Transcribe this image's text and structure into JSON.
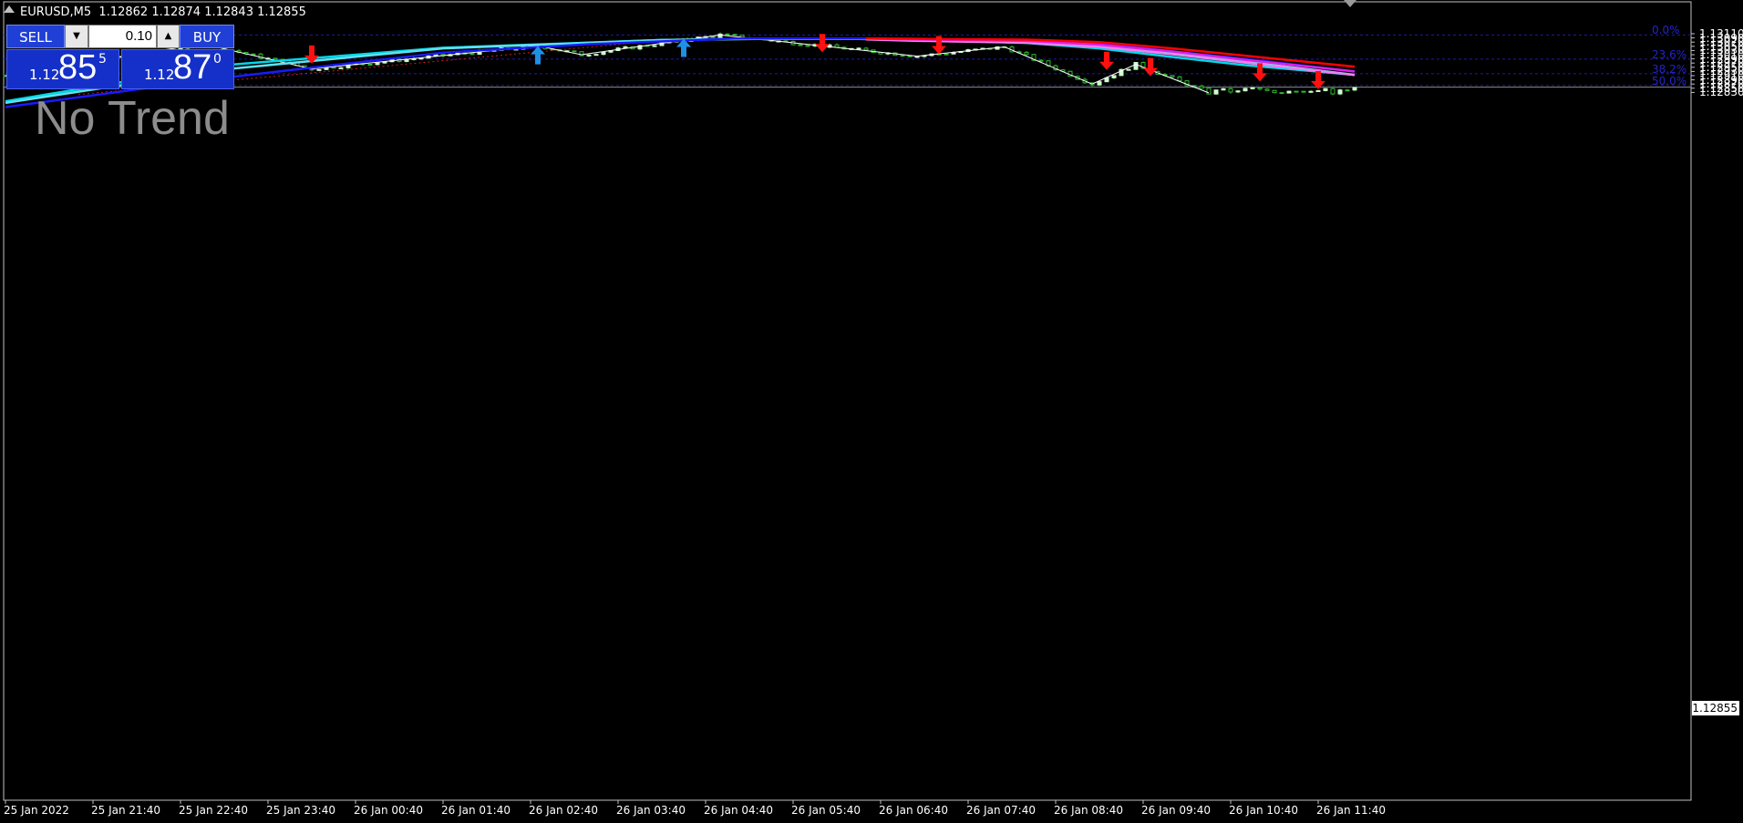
{
  "header": {
    "title": "EURUSD,M5  1.12862 1.12874 1.12843 1.12855"
  },
  "trade_panel": {
    "sell_label": "SELL",
    "buy_label": "BUY",
    "lot": "0.10",
    "sell_small": "1.12",
    "sell_big": "85",
    "sell_sup": "5",
    "buy_small": "1.12",
    "buy_big": "87",
    "buy_sup": "0"
  },
  "trend_label": "No Trend",
  "price_axis": [
    "1.13110",
    "1.13090",
    "1.13070",
    "1.13050",
    "1.13030",
    "1.13010",
    "1.12990",
    "1.12970",
    "1.12950",
    "1.12930",
    "1.12910",
    "1.12890",
    "1.12870",
    "1.12850",
    "1.12830"
  ],
  "current_price": "1.12855",
  "fib_levels": [
    {
      "label": "0.0%",
      "price": 1.13104
    },
    {
      "label": "23.6%",
      "price": 1.12989
    },
    {
      "label": "38.2%",
      "price": 1.12919
    },
    {
      "label": "50.0%",
      "price": 1.12863
    }
  ],
  "time_axis": [
    "25 Jan 2022",
    "25 Jan 21:40",
    "25 Jan 22:40",
    "25 Jan 23:40",
    "26 Jan 00:40",
    "26 Jan 01:40",
    "26 Jan 02:40",
    "26 Jan 03:40",
    "26 Jan 04:40",
    "26 Jan 05:40",
    "26 Jan 06:40",
    "26 Jan 07:40",
    "26 Jan 08:40",
    "26 Jan 09:40",
    "26 Jan 10:40",
    "26 Jan 11:40"
  ],
  "colors": {
    "background": "#000000",
    "bull_candle": "#ccffcc",
    "bear_candle": "#000000",
    "wick": "#2db82d",
    "grid_fib": "#1c1ca8",
    "zigzag": "#ffffff",
    "trend_dotted": "#d01a1a",
    "arrow_up": "#1e90e6",
    "arrow_down": "#ff1010",
    "ma_cyan": "#00d8e8",
    "ma_lightcyan": "#60e0f0",
    "ma_blue": "#1a1aff",
    "ma_red": "#ff0000",
    "ma_magenta": "#e020e0",
    "ma_pink": "#f080f0"
  },
  "chart_data": {
    "type": "candlestick",
    "symbol": "EURUSD",
    "timeframe": "M5",
    "ylim": [
      1.1282,
      1.13118
    ],
    "zigzag": [
      [
        0,
        1.1291
      ],
      [
        27,
        1.13062
      ],
      [
        42,
        1.12942
      ],
      [
        73,
        1.13052
      ],
      [
        79,
        1.1301
      ],
      [
        98,
        1.13104
      ],
      [
        125,
        1.13003
      ],
      [
        137,
        1.13047
      ],
      [
        149,
        1.1287
      ],
      [
        155,
        1.12964
      ],
      [
        165,
        1.12828
      ]
    ],
    "arrows_up": [
      [
        4,
        1.1293
      ],
      [
        13,
        1.1297
      ],
      [
        23,
        1.12985
      ],
      [
        73,
        1.13003
      ],
      [
        93,
        1.13038
      ]
    ],
    "arrows_down": [
      [
        42,
        1.13015
      ],
      [
        112,
        1.1307
      ],
      [
        128,
        1.1306
      ],
      [
        151,
        1.12985
      ],
      [
        157,
        1.12955
      ],
      [
        172,
        1.1293
      ],
      [
        180,
        1.12893
      ]
    ],
    "ma_cyan": [
      [
        0,
        1.12788
      ],
      [
        30,
        1.1296
      ],
      [
        60,
        1.13043
      ],
      [
        90,
        1.1308
      ],
      [
        103,
        1.13087
      ],
      [
        115,
        1.13087
      ],
      [
        120,
        1.13086
      ],
      [
        130,
        1.13077
      ],
      [
        140,
        1.13066
      ],
      [
        150,
        1.1304
      ],
      [
        160,
        1.12999
      ],
      [
        170,
        1.1296
      ],
      [
        185,
        1.12914
      ]
    ],
    "ma_lightcyan": [
      [
        0,
        1.1278
      ],
      [
        30,
        1.1294
      ],
      [
        60,
        1.1304
      ],
      [
        90,
        1.1308
      ],
      [
        103,
        1.13085
      ],
      [
        117,
        1.13085
      ],
      [
        122,
        1.13082
      ],
      [
        130,
        1.13077
      ],
      [
        140,
        1.13071
      ],
      [
        150,
        1.13058
      ],
      [
        160,
        1.13018
      ],
      [
        170,
        1.12977
      ],
      [
        185,
        1.12914
      ]
    ],
    "ma_blue": [
      [
        0,
        1.1276
      ],
      [
        30,
        1.129
      ],
      [
        60,
        1.1302
      ],
      [
        80,
        1.1306
      ],
      [
        100,
        1.13087
      ],
      [
        118,
        1.13087
      ],
      [
        124,
        1.1308
      ],
      [
        130,
        1.1308
      ],
      [
        140,
        1.13081
      ],
      [
        150,
        1.13065
      ],
      [
        160,
        1.13026
      ],
      [
        170,
        1.1299
      ],
      [
        185,
        1.1293
      ]
    ],
    "ma_red": [
      [
        118,
        1.13087
      ],
      [
        124,
        1.13086
      ],
      [
        130,
        1.13084
      ],
      [
        140,
        1.13082
      ],
      [
        150,
        1.1307
      ],
      [
        160,
        1.1304
      ],
      [
        170,
        1.13005
      ],
      [
        185,
        1.12953
      ]
    ],
    "ma_magenta": [
      [
        118,
        1.13087
      ],
      [
        124,
        1.13083
      ],
      [
        130,
        1.1308
      ],
      [
        140,
        1.13076
      ],
      [
        150,
        1.13058
      ],
      [
        160,
        1.13025
      ],
      [
        170,
        1.12985
      ],
      [
        185,
        1.1293
      ]
    ],
    "ma_pink": [
      [
        118,
        1.13083
      ],
      [
        124,
        1.13077
      ],
      [
        130,
        1.13073
      ],
      [
        140,
        1.13067
      ],
      [
        150,
        1.13048
      ],
      [
        160,
        1.13012
      ],
      [
        170,
        1.12972
      ],
      [
        185,
        1.12913
      ]
    ],
    "candles_note": "OHLC generated from the path defined in the script"
  }
}
